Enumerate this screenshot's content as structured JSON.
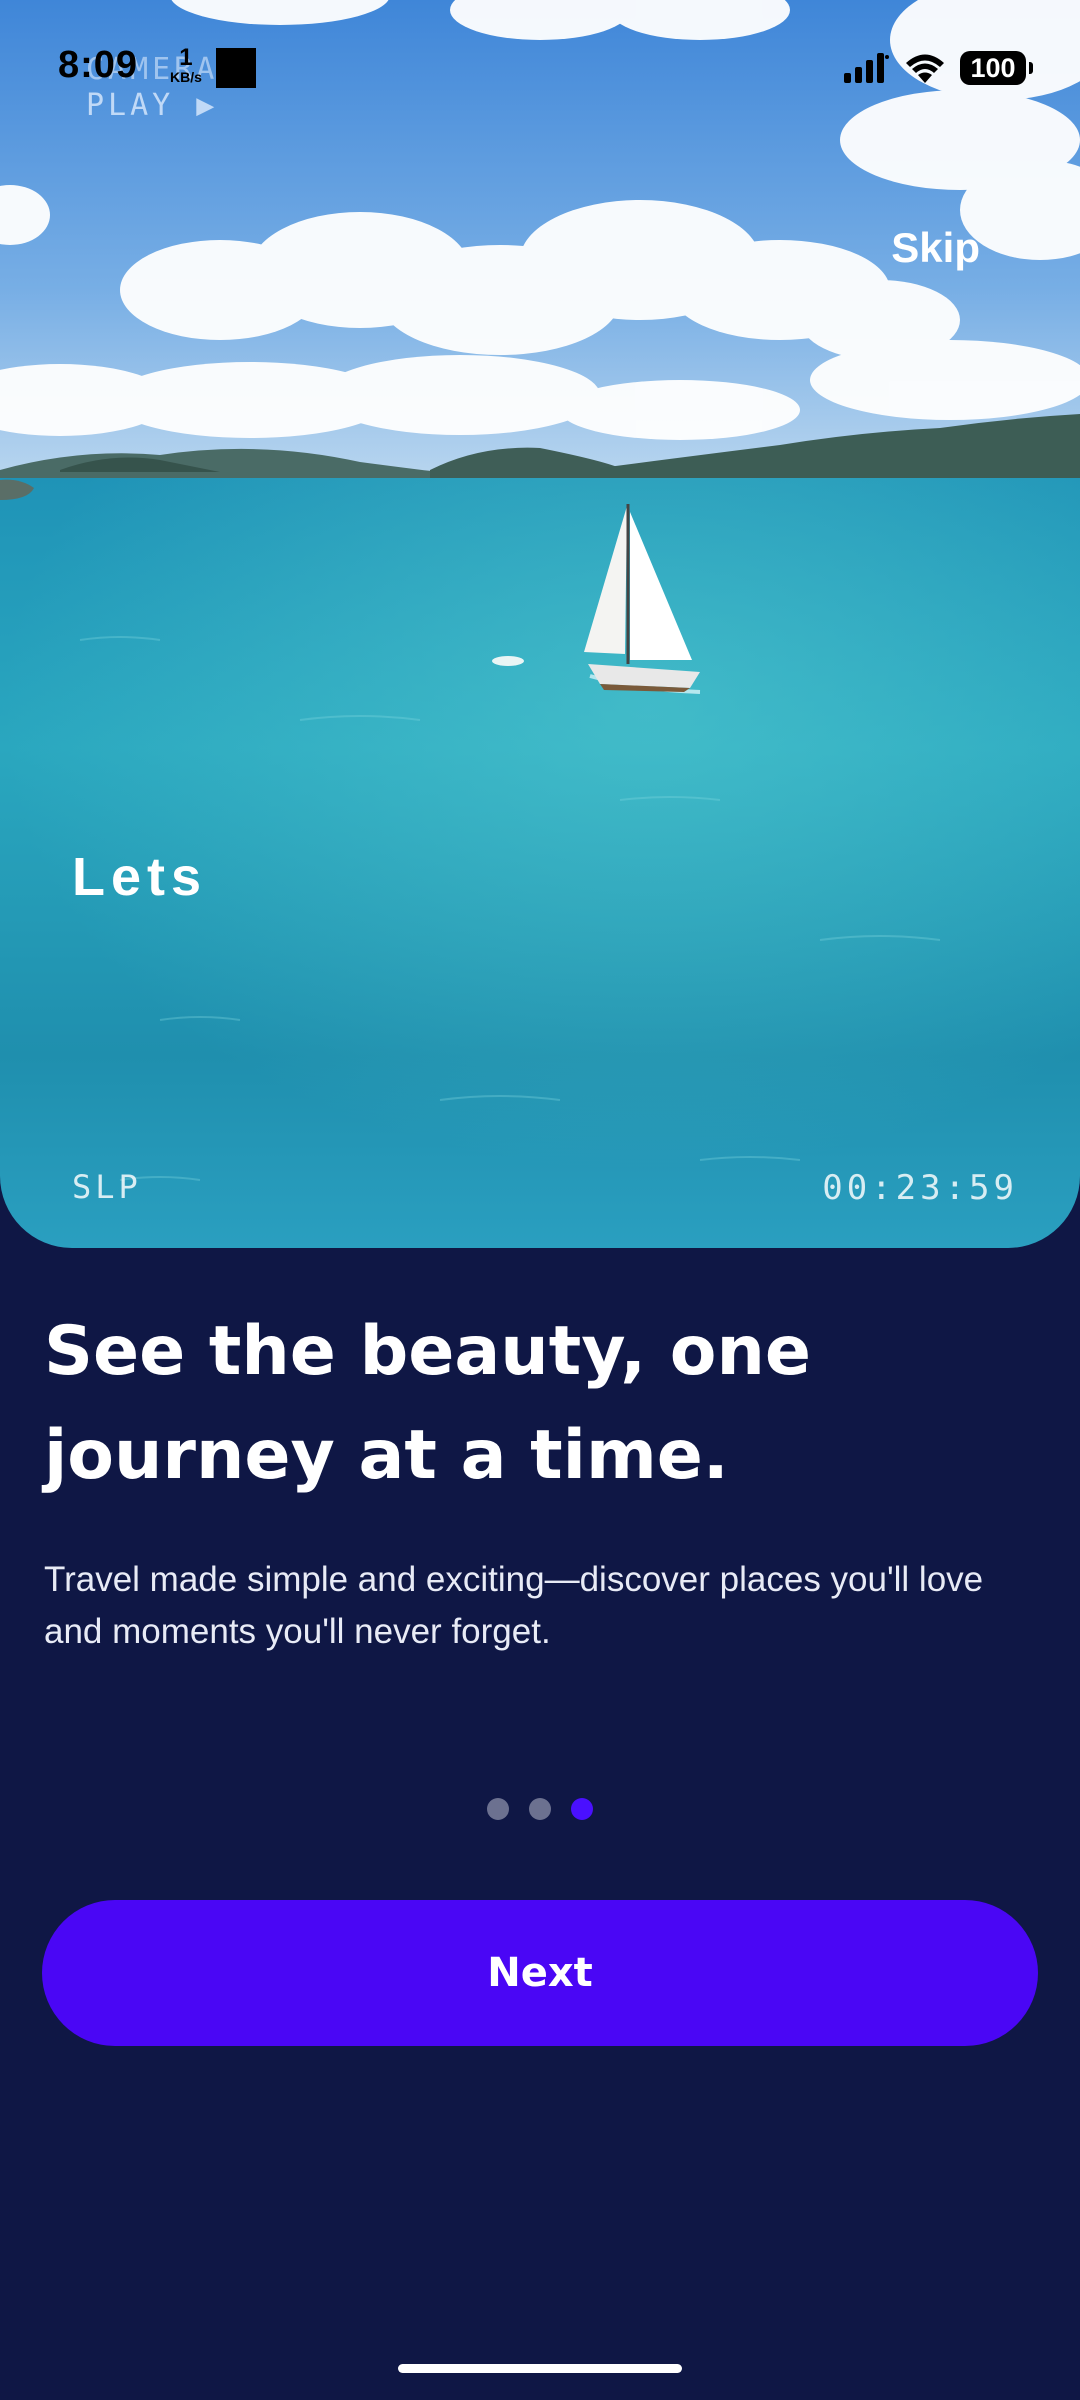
{
  "status_bar": {
    "time": "8:09",
    "net_speed_value": "1",
    "net_speed_unit": "KB/s",
    "battery": "100",
    "icons": [
      "signal-icon",
      "wifi-icon",
      "battery-icon"
    ]
  },
  "video": {
    "camera_label": "CAMERA1",
    "play_label": "PLAY ▶",
    "overlay_word": "Lets",
    "mode": "SLP",
    "timecode": "00:23:59"
  },
  "skip_label": "Skip",
  "headline": "See the beauty, one journey at a time.",
  "subtitle": "Travel made simple and exciting—discover places you'll love and moments you'll never forget.",
  "pagination": {
    "total": 3,
    "active_index": 2
  },
  "next_label": "Next",
  "colors": {
    "background": "#0f1745",
    "accent": "#4a06f5",
    "dot_inactive": "#6c7190"
  }
}
